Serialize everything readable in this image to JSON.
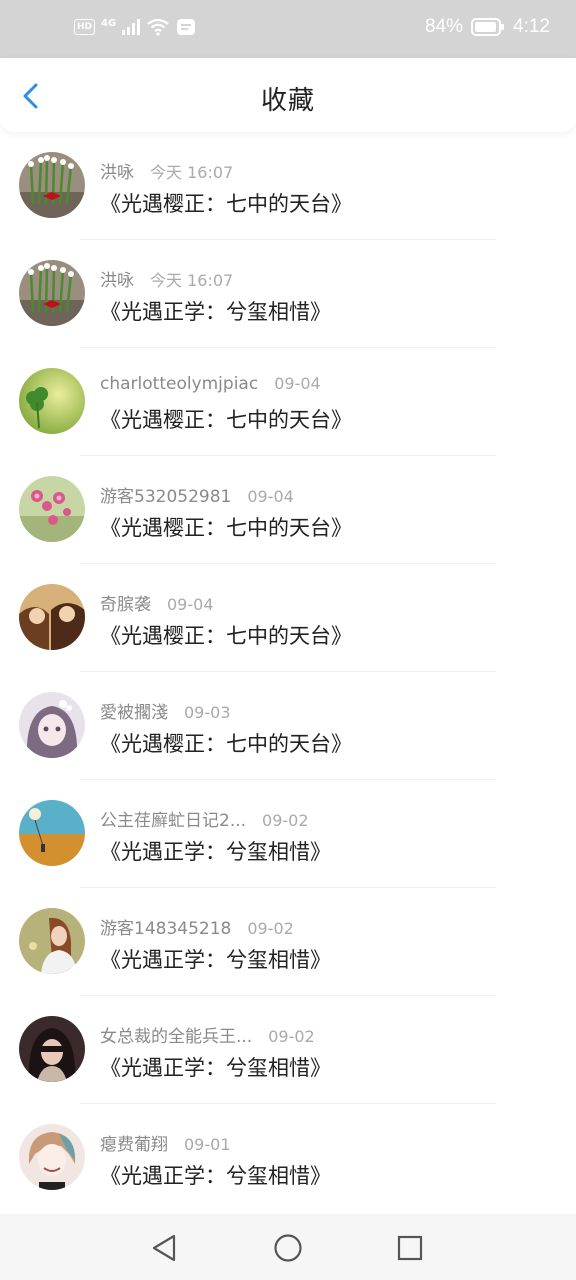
{
  "status_bar": {
    "hd": "HD",
    "network": "4G",
    "battery": "84%",
    "time": "4:12"
  },
  "header": {
    "title": "收藏"
  },
  "items": [
    {
      "name": "洪咏",
      "time": "今天 16:07",
      "book": "《光遇樱正：七中的天台》",
      "avatar": "flowers-avatar"
    },
    {
      "name": "洪咏",
      "time": "今天 16:07",
      "book": "《光遇正学：兮玺相惜》",
      "avatar": "flowers-avatar"
    },
    {
      "name": "charlotteolymjpiac",
      "time": "09-04",
      "book": "《光遇樱正：七中的天台》",
      "avatar": "clover-avatar"
    },
    {
      "name": "游客532052981",
      "time": "09-04",
      "book": "《光遇樱正：七中的天台》",
      "avatar": "blossom-avatar"
    },
    {
      "name": "奇膑袭",
      "time": "09-04",
      "book": "《光遇樱正：七中的天台》",
      "avatar": "girls-avatar"
    },
    {
      "name": "愛被擱淺",
      "time": "09-03",
      "book": "《光遇樱正：七中的天台》",
      "avatar": "anime-girl-avatar"
    },
    {
      "name": "公主荏廯虻日记2...",
      "time": "09-02",
      "book": "《光遇正学：兮玺相惜》",
      "avatar": "field-avatar"
    },
    {
      "name": "游客148345218",
      "time": "09-02",
      "book": "《光遇正学：兮玺相惜》",
      "avatar": "portrait-avatar"
    },
    {
      "name": "女总裁的全能兵王...",
      "time": "09-02",
      "book": "《光遇正学：兮玺相惜》",
      "avatar": "dark-girl-avatar"
    },
    {
      "name": "瘪费葡翔",
      "time": "09-01",
      "book": "《光遇正学：兮玺相惜》",
      "avatar": "anime-boy-avatar"
    }
  ],
  "colors": {
    "accent": "#2f8de4",
    "status_bar": "#d4d4d4"
  }
}
